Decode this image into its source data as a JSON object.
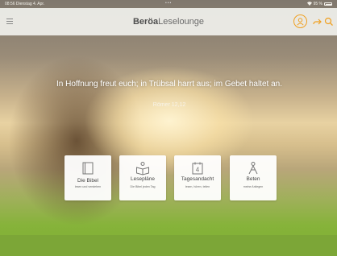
{
  "status_bar": {
    "time_date": "08:56 Dienstag 4. Apr.",
    "dots": "•••",
    "battery": "95 %"
  },
  "navbar": {
    "logo_bold": "Beröa",
    "logo_rest": "Leselounge",
    "accent_color": "#f0a020"
  },
  "hero": {
    "verse": "In Hoffnung freut euch; in Trübsal harrt aus; im Gebet haltet an.",
    "reference": "Römer 12,12"
  },
  "tiles": [
    {
      "title": "Die Bibel",
      "subtitle": "lesen und verstehen",
      "icon": "bible-icon"
    },
    {
      "title": "Lesepläne",
      "subtitle": "Die Bibel jeden Tag",
      "icon": "reading-plan-icon"
    },
    {
      "title": "Tagesandacht",
      "subtitle": "lesen, hören, teilen",
      "icon": "calendar-icon",
      "icon_number": "4"
    },
    {
      "title": "Beten",
      "subtitle": "meine Anliegen",
      "icon": "prayer-icon"
    }
  ],
  "icons": {
    "menu": "menu-icon",
    "user": "user-icon",
    "share": "share-icon",
    "search": "search-icon"
  }
}
